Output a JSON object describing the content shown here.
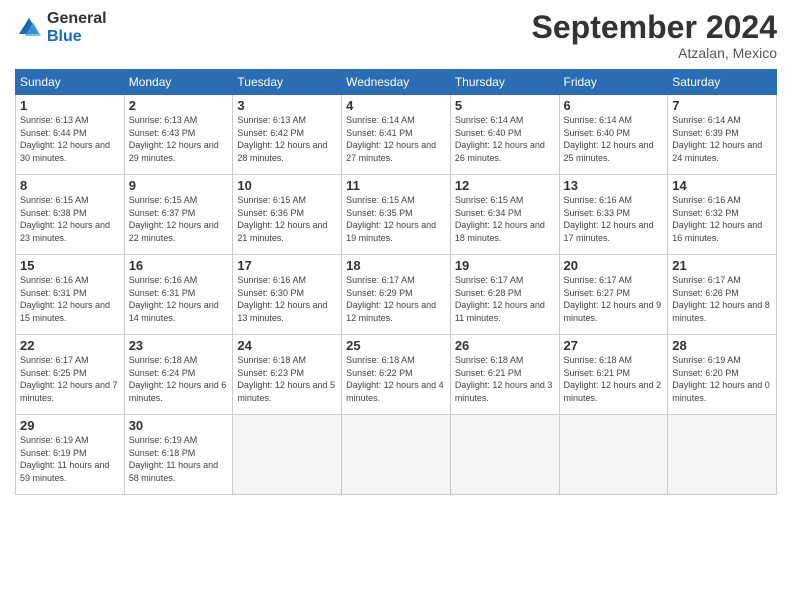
{
  "logo": {
    "general": "General",
    "blue": "Blue"
  },
  "title": "September 2024",
  "location": "Atzalan, Mexico",
  "days_of_week": [
    "Sunday",
    "Monday",
    "Tuesday",
    "Wednesday",
    "Thursday",
    "Friday",
    "Saturday"
  ],
  "weeks": [
    [
      {
        "day": "1",
        "sunrise": "6:13 AM",
        "sunset": "6:44 PM",
        "daylight": "12 hours and 30 minutes."
      },
      {
        "day": "2",
        "sunrise": "6:13 AM",
        "sunset": "6:43 PM",
        "daylight": "12 hours and 29 minutes."
      },
      {
        "day": "3",
        "sunrise": "6:13 AM",
        "sunset": "6:42 PM",
        "daylight": "12 hours and 28 minutes."
      },
      {
        "day": "4",
        "sunrise": "6:14 AM",
        "sunset": "6:41 PM",
        "daylight": "12 hours and 27 minutes."
      },
      {
        "day": "5",
        "sunrise": "6:14 AM",
        "sunset": "6:40 PM",
        "daylight": "12 hours and 26 minutes."
      },
      {
        "day": "6",
        "sunrise": "6:14 AM",
        "sunset": "6:40 PM",
        "daylight": "12 hours and 25 minutes."
      },
      {
        "day": "7",
        "sunrise": "6:14 AM",
        "sunset": "6:39 PM",
        "daylight": "12 hours and 24 minutes."
      }
    ],
    [
      {
        "day": "8",
        "sunrise": "6:15 AM",
        "sunset": "6:38 PM",
        "daylight": "12 hours and 23 minutes."
      },
      {
        "day": "9",
        "sunrise": "6:15 AM",
        "sunset": "6:37 PM",
        "daylight": "12 hours and 22 minutes."
      },
      {
        "day": "10",
        "sunrise": "6:15 AM",
        "sunset": "6:36 PM",
        "daylight": "12 hours and 21 minutes."
      },
      {
        "day": "11",
        "sunrise": "6:15 AM",
        "sunset": "6:35 PM",
        "daylight": "12 hours and 19 minutes."
      },
      {
        "day": "12",
        "sunrise": "6:15 AM",
        "sunset": "6:34 PM",
        "daylight": "12 hours and 18 minutes."
      },
      {
        "day": "13",
        "sunrise": "6:16 AM",
        "sunset": "6:33 PM",
        "daylight": "12 hours and 17 minutes."
      },
      {
        "day": "14",
        "sunrise": "6:16 AM",
        "sunset": "6:32 PM",
        "daylight": "12 hours and 16 minutes."
      }
    ],
    [
      {
        "day": "15",
        "sunrise": "6:16 AM",
        "sunset": "6:31 PM",
        "daylight": "12 hours and 15 minutes."
      },
      {
        "day": "16",
        "sunrise": "6:16 AM",
        "sunset": "6:31 PM",
        "daylight": "12 hours and 14 minutes."
      },
      {
        "day": "17",
        "sunrise": "6:16 AM",
        "sunset": "6:30 PM",
        "daylight": "12 hours and 13 minutes."
      },
      {
        "day": "18",
        "sunrise": "6:17 AM",
        "sunset": "6:29 PM",
        "daylight": "12 hours and 12 minutes."
      },
      {
        "day": "19",
        "sunrise": "6:17 AM",
        "sunset": "6:28 PM",
        "daylight": "12 hours and 11 minutes."
      },
      {
        "day": "20",
        "sunrise": "6:17 AM",
        "sunset": "6:27 PM",
        "daylight": "12 hours and 9 minutes."
      },
      {
        "day": "21",
        "sunrise": "6:17 AM",
        "sunset": "6:26 PM",
        "daylight": "12 hours and 8 minutes."
      }
    ],
    [
      {
        "day": "22",
        "sunrise": "6:17 AM",
        "sunset": "6:25 PM",
        "daylight": "12 hours and 7 minutes."
      },
      {
        "day": "23",
        "sunrise": "6:18 AM",
        "sunset": "6:24 PM",
        "daylight": "12 hours and 6 minutes."
      },
      {
        "day": "24",
        "sunrise": "6:18 AM",
        "sunset": "6:23 PM",
        "daylight": "12 hours and 5 minutes."
      },
      {
        "day": "25",
        "sunrise": "6:18 AM",
        "sunset": "6:22 PM",
        "daylight": "12 hours and 4 minutes."
      },
      {
        "day": "26",
        "sunrise": "6:18 AM",
        "sunset": "6:21 PM",
        "daylight": "12 hours and 3 minutes."
      },
      {
        "day": "27",
        "sunrise": "6:18 AM",
        "sunset": "6:21 PM",
        "daylight": "12 hours and 2 minutes."
      },
      {
        "day": "28",
        "sunrise": "6:19 AM",
        "sunset": "6:20 PM",
        "daylight": "12 hours and 0 minutes."
      }
    ],
    [
      {
        "day": "29",
        "sunrise": "6:19 AM",
        "sunset": "6:19 PM",
        "daylight": "11 hours and 59 minutes."
      },
      {
        "day": "30",
        "sunrise": "6:19 AM",
        "sunset": "6:18 PM",
        "daylight": "11 hours and 58 minutes."
      },
      null,
      null,
      null,
      null,
      null
    ]
  ],
  "labels": {
    "sunrise": "Sunrise:",
    "sunset": "Sunset:",
    "daylight": "Daylight:"
  }
}
